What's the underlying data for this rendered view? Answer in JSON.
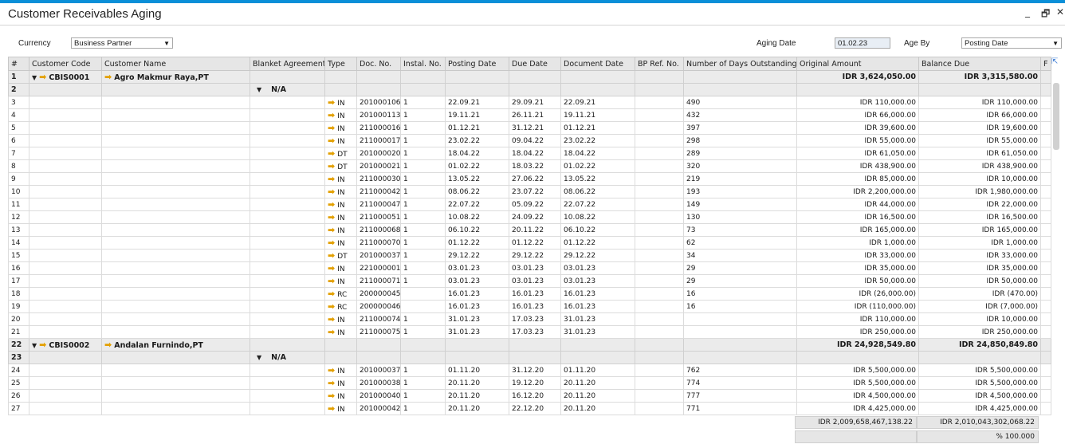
{
  "window": {
    "title": "Customer Receivables Aging",
    "controls": [
      "_",
      "🗗",
      "✕"
    ]
  },
  "filters": {
    "currency_label": "Currency",
    "currency_value": "Business Partner",
    "aging_date_label": "Aging Date",
    "aging_date_value": "01.02.23",
    "age_by_label": "Age By",
    "age_by_value": "Posting Date"
  },
  "columns": [
    "#",
    "Customer Code",
    "Customer Name",
    "Blanket Agreement",
    "Type",
    "Doc. No.",
    "Instal. No.",
    "Posting Date",
    "Due Date",
    "Document Date",
    "BP Ref. No.",
    "Number of Days Outstanding",
    "Original Amount",
    "Balance Due",
    "F"
  ],
  "groups": [
    {
      "row": "1",
      "code": "CBIS0001",
      "name": "Agro Makmur Raya,PT",
      "original": "IDR  3,624,050.00",
      "balance": "IDR  3,315,580.00",
      "sub_row": "2",
      "sub_label": "N/A",
      "rows": [
        [
          "3",
          "IN",
          "201000106",
          "1",
          "22.09.21",
          "29.09.21",
          "22.09.21",
          "490",
          "IDR  110,000.00",
          "IDR  110,000.00"
        ],
        [
          "4",
          "IN",
          "201000113",
          "1",
          "19.11.21",
          "26.11.21",
          "19.11.21",
          "432",
          "IDR  66,000.00",
          "IDR  66,000.00"
        ],
        [
          "5",
          "IN",
          "211000016",
          "1",
          "01.12.21",
          "31.12.21",
          "01.12.21",
          "397",
          "IDR  39,600.00",
          "IDR  19,600.00"
        ],
        [
          "6",
          "IN",
          "211000017",
          "1",
          "23.02.22",
          "09.04.22",
          "23.02.22",
          "298",
          "IDR  55,000.00",
          "IDR  55,000.00"
        ],
        [
          "7",
          "DT",
          "201000020",
          "1",
          "18.04.22",
          "18.04.22",
          "18.04.22",
          "289",
          "IDR  61,050.00",
          "IDR  61,050.00"
        ],
        [
          "8",
          "DT",
          "201000021",
          "1",
          "01.02.22",
          "18.03.22",
          "01.02.22",
          "320",
          "IDR  438,900.00",
          "IDR  438,900.00"
        ],
        [
          "9",
          "IN",
          "211000030",
          "1",
          "13.05.22",
          "27.06.22",
          "13.05.22",
          "219",
          "IDR  85,000.00",
          "IDR  10,000.00"
        ],
        [
          "10",
          "IN",
          "211000042",
          "1",
          "08.06.22",
          "23.07.22",
          "08.06.22",
          "193",
          "IDR  2,200,000.00",
          "IDR  1,980,000.00"
        ],
        [
          "11",
          "IN",
          "211000047",
          "1",
          "22.07.22",
          "05.09.22",
          "22.07.22",
          "149",
          "IDR  44,000.00",
          "IDR  22,000.00"
        ],
        [
          "12",
          "IN",
          "211000051",
          "1",
          "10.08.22",
          "24.09.22",
          "10.08.22",
          "130",
          "IDR  16,500.00",
          "IDR  16,500.00"
        ],
        [
          "13",
          "IN",
          "211000068",
          "1",
          "06.10.22",
          "20.11.22",
          "06.10.22",
          "73",
          "IDR  165,000.00",
          "IDR  165,000.00"
        ],
        [
          "14",
          "IN",
          "211000070",
          "1",
          "01.12.22",
          "01.12.22",
          "01.12.22",
          "62",
          "IDR  1,000.00",
          "IDR  1,000.00"
        ],
        [
          "15",
          "DT",
          "201000037",
          "1",
          "29.12.22",
          "29.12.22",
          "29.12.22",
          "34",
          "IDR  33,000.00",
          "IDR  33,000.00"
        ],
        [
          "16",
          "IN",
          "221000001",
          "1",
          "03.01.23",
          "03.01.23",
          "03.01.23",
          "29",
          "IDR  35,000.00",
          "IDR  35,000.00"
        ],
        [
          "17",
          "IN",
          "211000071",
          "1",
          "03.01.23",
          "03.01.23",
          "03.01.23",
          "29",
          "IDR  50,000.00",
          "IDR  50,000.00"
        ],
        [
          "18",
          "RC",
          "200000045",
          "",
          "16.01.23",
          "16.01.23",
          "16.01.23",
          "16",
          "IDR  (26,000.00)",
          "IDR  (470.00)"
        ],
        [
          "19",
          "RC",
          "200000046",
          "",
          "16.01.23",
          "16.01.23",
          "16.01.23",
          "16",
          "IDR  (110,000.00)",
          "IDR  (7,000.00)"
        ],
        [
          "20",
          "IN",
          "211000074",
          "1",
          "31.01.23",
          "17.03.23",
          "31.01.23",
          "",
          "IDR  110,000.00",
          "IDR  10,000.00"
        ],
        [
          "21",
          "IN",
          "211000075",
          "1",
          "31.01.23",
          "17.03.23",
          "31.01.23",
          "",
          "IDR  250,000.00",
          "IDR  250,000.00"
        ]
      ]
    },
    {
      "row": "22",
      "code": "CBIS0002",
      "name": "Andalan Furnindo,PT",
      "original": "IDR  24,928,549.80",
      "balance": "IDR  24,850,849.80",
      "sub_row": "23",
      "sub_label": "N/A",
      "rows": [
        [
          "24",
          "IN",
          "201000037",
          "1",
          "01.11.20",
          "31.12.20",
          "01.11.20",
          "762",
          "IDR  5,500,000.00",
          "IDR  5,500,000.00"
        ],
        [
          "25",
          "IN",
          "201000038",
          "1",
          "20.11.20",
          "19.12.20",
          "20.11.20",
          "774",
          "IDR  5,500,000.00",
          "IDR  5,500,000.00"
        ],
        [
          "26",
          "IN",
          "201000040",
          "1",
          "20.11.20",
          "16.12.20",
          "20.11.20",
          "777",
          "IDR  4,500,000.00",
          "IDR  4,500,000.00"
        ],
        [
          "27",
          "IN",
          "201000042",
          "1",
          "20.11.20",
          "22.12.20",
          "20.11.20",
          "771",
          "IDR  4,425,000.00",
          "IDR  4,425,000.00"
        ]
      ]
    }
  ],
  "totals": {
    "original": "IDR  2,009,658,467,138.22",
    "balance": "IDR  2,010,043,302,068.22",
    "percent": "% 100.000"
  }
}
